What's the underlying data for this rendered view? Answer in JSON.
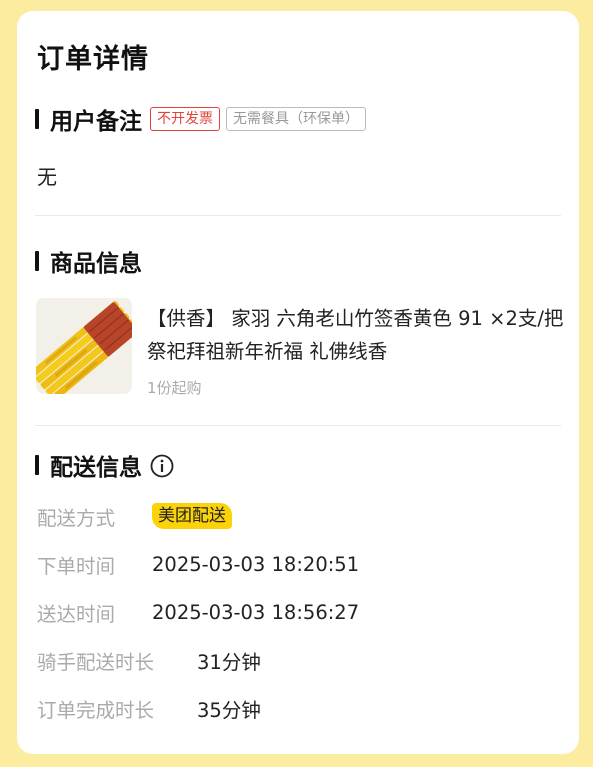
{
  "page": {
    "title": "订单详情"
  },
  "remark_section": {
    "title": "用户备注",
    "tags": [
      "不开发票",
      "无需餐具（环保单）"
    ],
    "text": "无"
  },
  "product_section": {
    "title": "商品信息",
    "product": {
      "name": "【供香】 家羽 六角老山竹签香黄色 91 ×2支/把 祭祀拜祖新年祈福 礼佛线香",
      "min_purchase": "1份起购",
      "image": "incense-bundle-image"
    }
  },
  "delivery_section": {
    "title": "配送信息",
    "icon": "info-icon",
    "rows": [
      {
        "label": "配送方式",
        "value": "美团配送"
      },
      {
        "label": "下单时间",
        "value": "2025-03-03 18:20:51"
      },
      {
        "label": "送达时间",
        "value": "2025-03-03 18:56:27"
      },
      {
        "label": "骑手配送时长",
        "value": "31分钟"
      },
      {
        "label": "订单完成时长",
        "value": "35分钟"
      }
    ]
  },
  "colors": {
    "background": "#fcec9f",
    "card": "#ffffff",
    "tag_red": "#e2433a",
    "badge_yellow": "#fcd209",
    "label_gray": "#aaaaaa"
  }
}
